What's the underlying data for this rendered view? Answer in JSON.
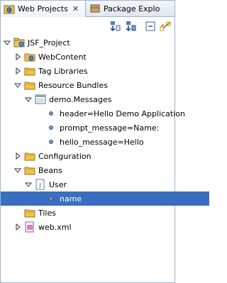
{
  "tabs": {
    "active_label": "Web Projects",
    "close_glyph": "✕",
    "inactive_label": "Package Explo"
  },
  "toolbar": {
    "buttons": [
      "sort-icon",
      "filter-icon",
      "collapse-all-icon",
      "link-with-editor-icon"
    ]
  },
  "tree": [
    {
      "label": "JSF_Project",
      "level": 0,
      "expanded": true,
      "icon": "project-icon"
    },
    {
      "label": "WebContent",
      "level": 1,
      "expanded": false,
      "icon": "web-folder-icon"
    },
    {
      "label": "Tag Libraries",
      "level": 1,
      "expanded": false,
      "icon": "folder-icon"
    },
    {
      "label": "Resource Bundles",
      "level": 1,
      "expanded": true,
      "icon": "folder-icon"
    },
    {
      "label": "demo.Messages",
      "level": 2,
      "expanded": true,
      "icon": "properties-icon"
    },
    {
      "label": "header=Hello Demo Application",
      "level": 3,
      "leaf": true,
      "icon": "property-icon"
    },
    {
      "label": "prompt_message=Name:",
      "level": 3,
      "leaf": true,
      "icon": "property-icon"
    },
    {
      "label": "hello_message=Hello",
      "level": 3,
      "leaf": true,
      "icon": "property-icon"
    },
    {
      "label": "Configuration",
      "level": 1,
      "expanded": false,
      "icon": "folder-icon"
    },
    {
      "label": "Beans",
      "level": 1,
      "expanded": true,
      "icon": "folder-icon"
    },
    {
      "label": "User",
      "level": 2,
      "expanded": true,
      "icon": "java-class-icon"
    },
    {
      "label": "name",
      "level": 3,
      "leaf": true,
      "icon": "property-icon",
      "selected": true
    },
    {
      "label": "Tiles",
      "level": 1,
      "leaf": true,
      "icon": "folder-icon"
    },
    {
      "label": "web.xml",
      "level": 1,
      "expanded": false,
      "icon": "xml-file-icon"
    }
  ],
  "colors": {
    "selection": "#3b6ec0",
    "border": "#9fb5cf",
    "folder": "#f0c24a"
  }
}
